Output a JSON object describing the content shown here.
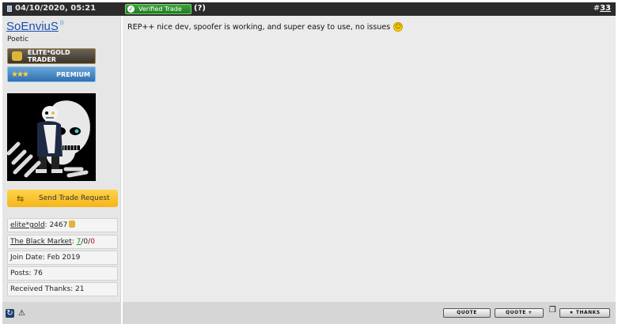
{
  "header": {
    "date": "04/10/2020, 05:21",
    "verified_label": "Verified Trade",
    "help_label": "(?)",
    "post_number_prefix": "#",
    "post_number": "33"
  },
  "user": {
    "name": "SoEnviuS",
    "title": "Poetic",
    "badges": [
      "ELITE*GOLD TRADER",
      "PREMIUM"
    ],
    "trade_button": "Send Trade Request",
    "stats": {
      "elite_gold_label": "elite*gold",
      "elite_gold_value": ": 2467",
      "market_label": "The Black Market",
      "market_sep": ": ",
      "market_pos": "7",
      "market_mid": "/0/",
      "market_neg": "0",
      "join_date": "Join Date: Feb 2019",
      "posts": "Posts: 76",
      "thanks": "Received Thanks: 21"
    }
  },
  "post": {
    "message": "REP++ nice dev, spoofer is working, and super easy to use, no issues"
  },
  "footer": {
    "quote": "QUOTE",
    "quote_plus": "QUOTE +",
    "thanks": "THANKS"
  },
  "colors": {
    "header_bg": "#2b2b2b",
    "verified_green": "#2e8f2e",
    "username_blue": "#1a4fb0",
    "trade_yellow": "#f5b51a",
    "market_green": "#1a8a1a",
    "market_red": "#cc0000"
  },
  "icons": [
    "doc-icon",
    "check-icon",
    "wifi-icon",
    "gold-icon",
    "stars-icon",
    "arrows-icon",
    "coin-icon",
    "smiley-icon",
    "refresh-icon",
    "warning-icon",
    "multiquote-icon",
    "star-icon"
  ]
}
